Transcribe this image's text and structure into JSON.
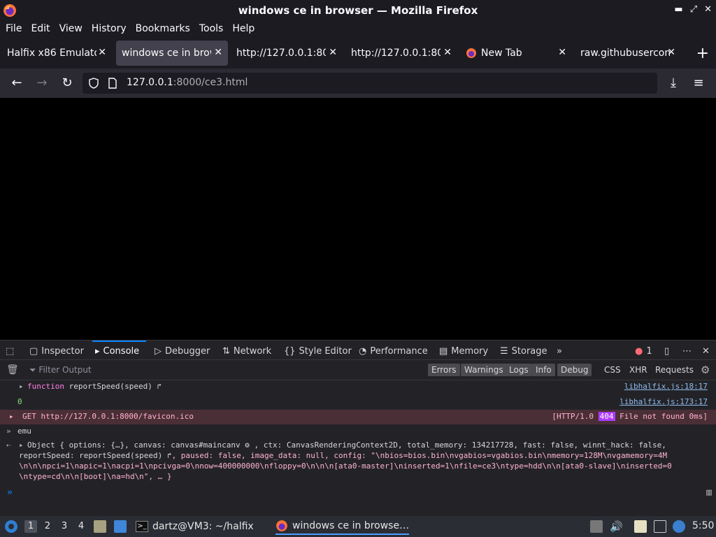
{
  "window": {
    "title": "windows ce in browser — Mozilla Firefox"
  },
  "menu": [
    "File",
    "Edit",
    "View",
    "History",
    "Bookmarks",
    "Tools",
    "Help"
  ],
  "tabs": [
    {
      "label": "Halfix x86 Emulator",
      "active": false,
      "favicon": false
    },
    {
      "label": "windows ce in browser",
      "active": true,
      "favicon": false
    },
    {
      "label": "http://127.0.0.1:8000/",
      "active": false,
      "favicon": false
    },
    {
      "label": "http://127.0.0.1:8000/",
      "active": false,
      "favicon": false
    },
    {
      "label": "New Tab",
      "active": false,
      "favicon": true
    },
    {
      "label": "raw.githubusercontent.com",
      "active": false,
      "favicon": false
    }
  ],
  "url": {
    "host": "127.0.0.1",
    "rest": ":8000/ce3.html"
  },
  "devtools": {
    "tabs": [
      "Inspector",
      "Console",
      "Debugger",
      "Network",
      "Style Editor",
      "Performance",
      "Memory",
      "Storage"
    ],
    "error_count": "1",
    "filter_placeholder": "Filter Output",
    "filters": [
      "Errors",
      "Warnings",
      "Logs",
      "Info",
      "Debug",
      "CSS",
      "XHR",
      "Requests"
    ],
    "rows": {
      "r1": {
        "text_a": "function ",
        "text_b": "reportSpeed(speed)",
        "src": "libhalfix.js:18:17"
      },
      "r2": {
        "text": "0",
        "src": "libhalfix.js:173:17"
      },
      "r3": {
        "method": "GET",
        "url": "http://127.0.0.1:8000/favicon.ico",
        "status_pre": "[HTTP/1.0",
        "code": "404",
        "status_post": "File not found 0ms]"
      },
      "r4": {
        "input": "emu"
      },
      "r5a": "Object { options: {…}, canvas: canvas#maincanv",
      "r5b": ", ctx: CanvasRenderingContext2D, total_memory: 134217728, fast: false, winnt_hack: false,",
      "r5c": "reportSpeed: reportSpeed(speed)",
      "r5d": ", paused: false, image_data: null, config: \"\\nbios=bios.bin\\nvgabios=vgabios.bin\\nmemory=128M\\nvgamemory=4M",
      "r5e": "\\n\\n\\npci=1\\napic=1\\nacpi=1\\npcivga=0\\nnow=400000000\\nfloppy=0\\n\\n\\n[ata0-master]\\ninserted=1\\nfile=ce3\\ntype=hdd\\n\\n[ata0-slave]\\ninserted=0",
      "r5f": "\\ntype=cd\\n\\n[boot]\\na=hd\\n\", … }"
    }
  },
  "taskbar": {
    "workspaces": [
      "1",
      "2",
      "3",
      "4"
    ],
    "task1": "dartz@VM3: ~/halfix",
    "task2": "windows ce in browse…",
    "clock": "5:50"
  }
}
